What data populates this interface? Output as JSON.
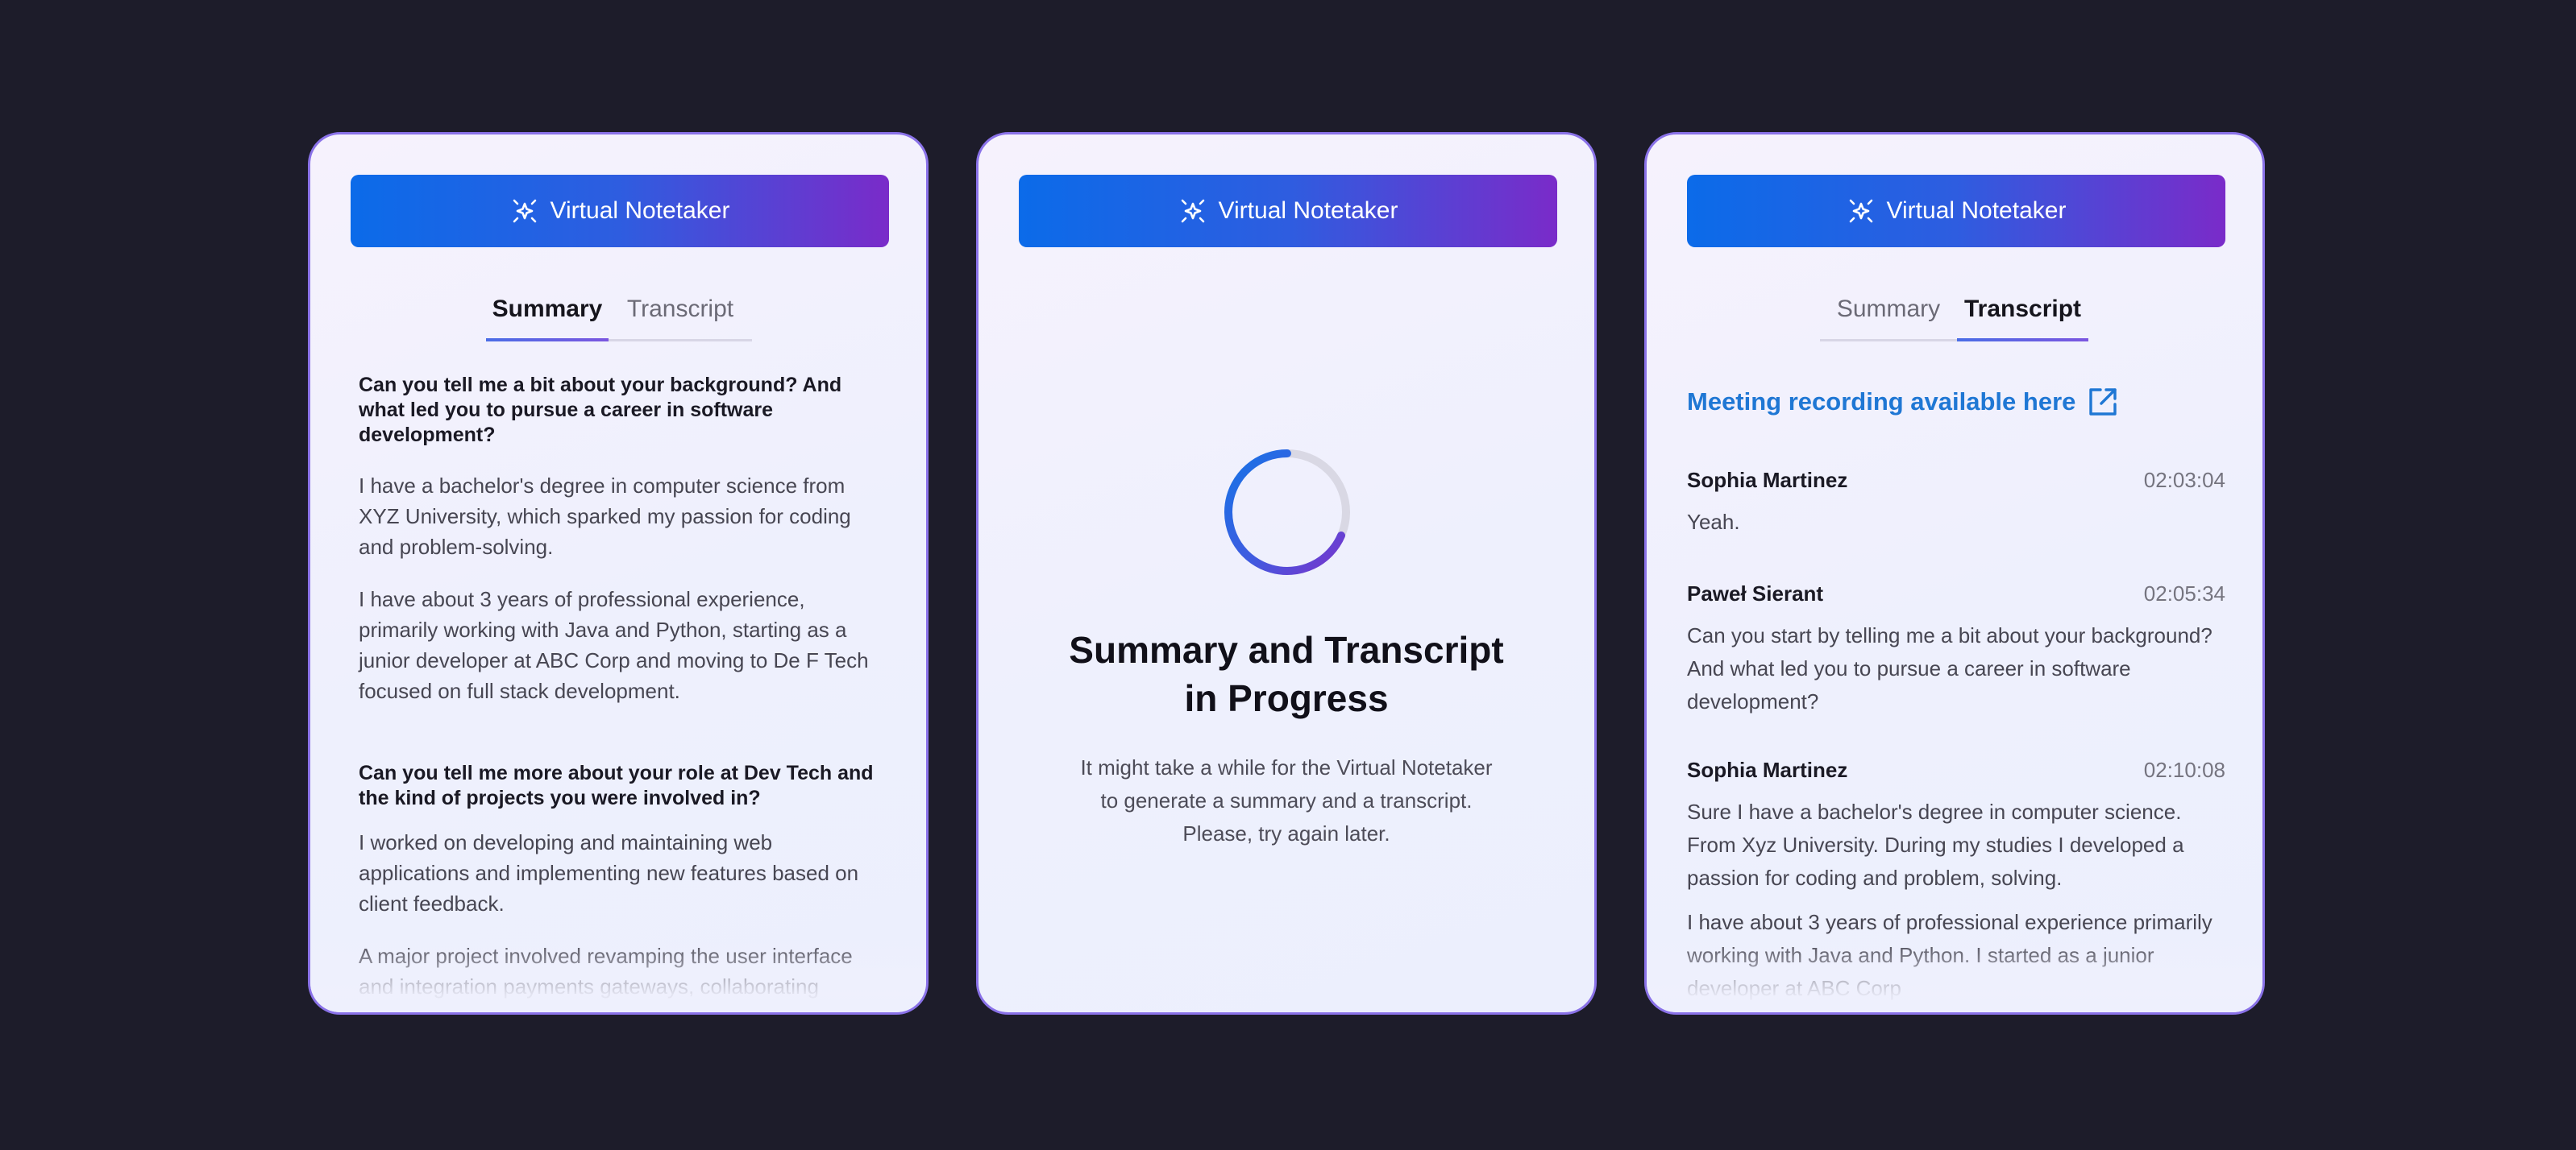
{
  "app_title": "Virtual Notetaker",
  "tabs": {
    "summary": "Summary",
    "transcript": "Transcript"
  },
  "summary": {
    "sections": [
      {
        "question": "Can you tell me a bit about your background? And what led you to pursue a career in software development?",
        "paragraphs": [
          "I have a bachelor's degree in computer science from XYZ University, which sparked my passion for coding and problem-solving.",
          "I have about 3 years of professional experience, primarily working with Java and Python, starting as a junior developer at ABC Corp and moving to De F Tech focused on full stack development."
        ]
      },
      {
        "question": "Can you tell me more about your role at Dev Tech and the kind of projects you were involved in?",
        "paragraphs": [
          "I worked on developing and maintaining web applications and implementing new features based on client feedback.",
          "A major project involved revamping the user interface and integration payments gateways, collaborating"
        ]
      }
    ]
  },
  "progress": {
    "title_line1": "Summary and Transcript",
    "title_line2": "in Progress",
    "desc_line1": "It might take a while for the Virtual Notetaker",
    "desc_line2": "to generate a summary and a transcript.",
    "desc_line3": "Please, try again later."
  },
  "transcript": {
    "recording_link": "Meeting recording available here",
    "entries": [
      {
        "speaker": "Sophia Martinez",
        "time": "02:03:04",
        "lines": [
          "Yeah."
        ]
      },
      {
        "speaker": "Paweł Sierant",
        "time": "02:05:34",
        "lines": [
          "Can you start by telling me a bit about your background? And what led you to pursue a career in software development?"
        ]
      },
      {
        "speaker": "Sophia Martinez",
        "time": "02:10:08",
        "lines": [
          "Sure I have a bachelor's degree in computer science. From Xyz University. During my studies I developed a passion for coding and problem, solving.",
          "I have about 3 years of professional experience primarily working with Java and Python. I started as a junior developer at ABC Corp"
        ]
      }
    ]
  },
  "colors": {
    "background": "#1d1c2a",
    "accent_blue": "#0b6be9",
    "accent_purple": "#7a2bc9",
    "link": "#1f77d4"
  }
}
